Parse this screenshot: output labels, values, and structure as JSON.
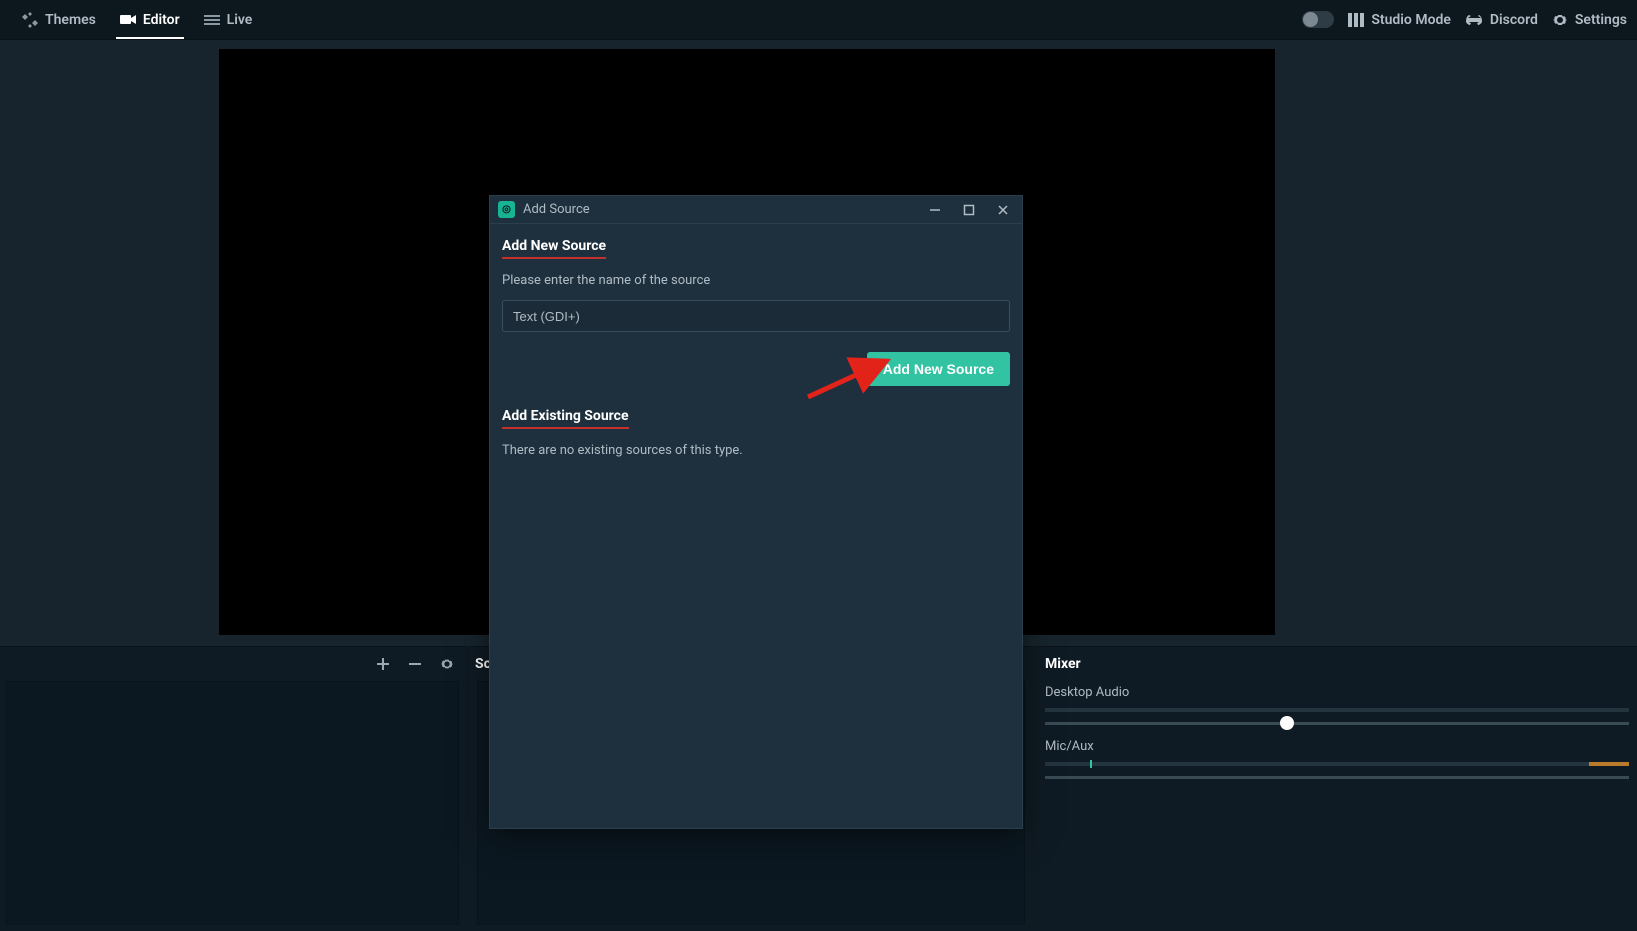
{
  "topbar": {
    "tabs": [
      {
        "label": "Themes"
      },
      {
        "label": "Editor"
      },
      {
        "label": "Live"
      }
    ],
    "studio_mode": "Studio Mode",
    "discord": "Discord",
    "settings": "Settings"
  },
  "panels": {
    "sources_label": "So",
    "mixer_label": "Mixer"
  },
  "mixer": {
    "channels": [
      {
        "name": "Desktop Audio"
      },
      {
        "name": "Mic/Aux"
      }
    ]
  },
  "modal": {
    "window_title": "Add Source",
    "section_new": "Add New Source",
    "hint": "Please enter the name of the source",
    "input_value": "Text (GDI+)",
    "add_button": "Add New Source",
    "section_existing": "Add Existing Source",
    "existing_empty": "There are no existing sources of this type."
  }
}
